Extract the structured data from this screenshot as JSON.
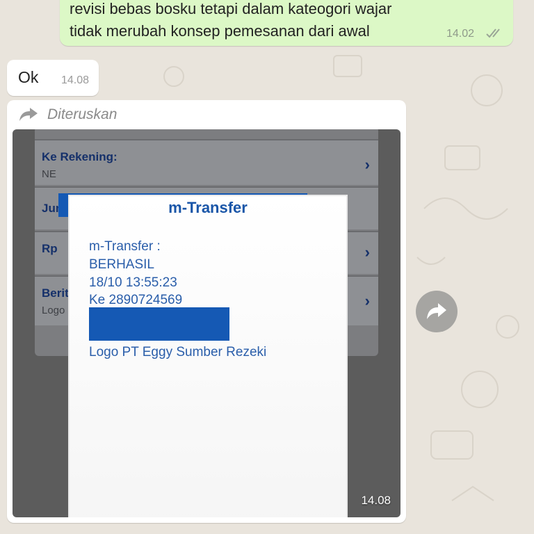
{
  "chat": {
    "outgoing": {
      "line1": "revisi bebas bosku tetapi dalam kateogori wajar",
      "line2": "tidak merubah konsep pemesanan dari awal",
      "time": "14.02",
      "status_icon": "double-check-icon"
    },
    "incoming_ok": {
      "text": "Ok",
      "time": "14.08"
    },
    "forwarded": {
      "label": "Diteruskan",
      "icon": "forward-arrow-icon",
      "time": "14.08",
      "image": {
        "app_rows": [
          {
            "label": "Ke Rekening:",
            "sub": "NE"
          },
          {
            "label": "Jum",
            "sub": ""
          },
          {
            "label": "Rp",
            "sub": ""
          },
          {
            "label": "Berit",
            "sub": "Logo"
          }
        ],
        "receipt": {
          "title": "m-Transfer",
          "lines": [
            "m-Transfer :",
            "BERHASIL",
            "18/10 13:55:23",
            "Ke 2890724569"
          ],
          "footer": "Logo PT Eggy Sumber Rezeki"
        }
      }
    }
  },
  "colors": {
    "outgoing_bubble": "#dcf8c6",
    "incoming_bubble": "#ffffff",
    "redaction": "#1559b4",
    "receipt_text": "#2a5eaa"
  }
}
